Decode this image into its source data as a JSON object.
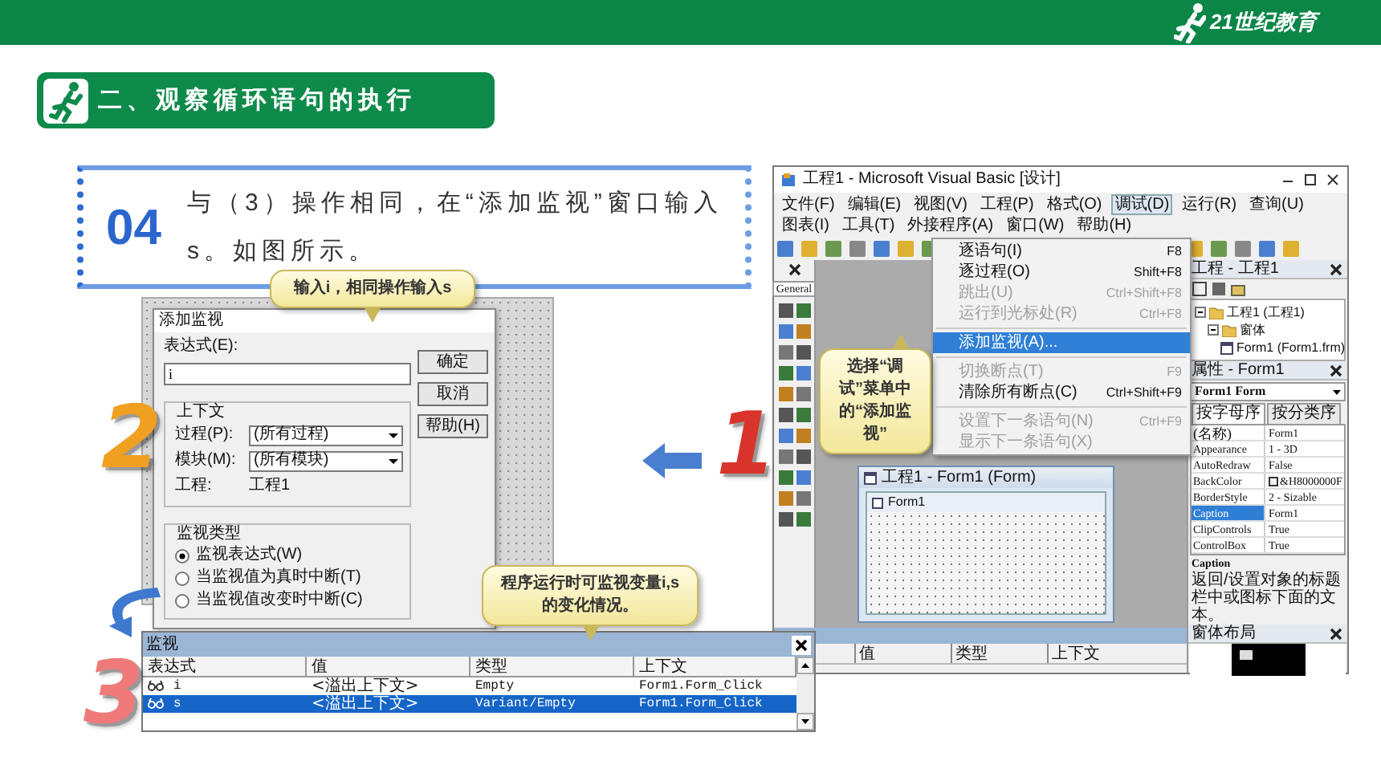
{
  "header": {
    "logo_text": "21世纪教育"
  },
  "section": {
    "title": "二、观察循环语句的执行"
  },
  "step": {
    "number": "04",
    "text": "与（3）操作相同，在“添加监视”窗口输入s。如图所示。"
  },
  "big_numbers": [
    {
      "label": "1",
      "color": "#d9342b"
    },
    {
      "label": "2",
      "color": "#f0a020"
    },
    {
      "label": "3",
      "color": "#f07a7a"
    }
  ],
  "vb": {
    "title": "工程1 - Microsoft Visual Basic [设计]",
    "menu": [
      {
        "label": "文件(F)",
        "selected": false
      },
      {
        "label": "编辑(E)",
        "selected": false
      },
      {
        "label": "视图(V)",
        "selected": false
      },
      {
        "label": "工程(P)",
        "selected": false
      },
      {
        "label": "格式(O)",
        "selected": false
      },
      {
        "label": "调试(D)",
        "selected": true
      },
      {
        "label": "运行(R)",
        "selected": false
      },
      {
        "label": "查询(U)",
        "selected": false
      },
      {
        "label": "图表(I)",
        "selected": false
      },
      {
        "label": "工具(T)",
        "selected": false
      },
      {
        "label": "外接程序(A)",
        "selected": false
      },
      {
        "label": "窗口(W)",
        "selected": false
      },
      {
        "label": "帮助(H)",
        "selected": false
      }
    ],
    "debug_menu": [
      {
        "kind": "item",
        "label": "逐语句(I)",
        "shortcut": "F8",
        "disabled": false,
        "selected": false
      },
      {
        "kind": "item",
        "label": "逐过程(O)",
        "shortcut": "Shift+F8",
        "disabled": false,
        "selected": false
      },
      {
        "kind": "item",
        "label": "跳出(U)",
        "shortcut": "Ctrl+Shift+F8",
        "disabled": true,
        "selected": false
      },
      {
        "kind": "item",
        "label": "运行到光标处(R)",
        "shortcut": "Ctrl+F8",
        "disabled": true,
        "selected": false
      },
      {
        "kind": "separator"
      },
      {
        "kind": "item",
        "label": "添加监视(A)...",
        "disabled": false,
        "selected": true
      },
      {
        "kind": "separator"
      },
      {
        "kind": "item",
        "label": "切换断点(T)",
        "shortcut": "F9",
        "disabled": true,
        "selected": false
      },
      {
        "kind": "item",
        "label": "清除所有断点(C)",
        "shortcut": "Ctrl+Shift+F9",
        "disabled": false,
        "selected": false
      },
      {
        "kind": "separator"
      },
      {
        "kind": "item",
        "label": "设置下一条语句(N)",
        "shortcut": "Ctrl+F9",
        "disabled": true,
        "selected": false
      },
      {
        "kind": "item",
        "label": "显示下一条语句(X)",
        "disabled": true,
        "selected": false
      }
    ],
    "callout": "选择“调试”菜单中的“添加监视”",
    "toolbox_title": "General",
    "form_window_title": "工程1 - Form1 (Form)",
    "form_title": "Form1",
    "project": {
      "title": "工程 - 工程1",
      "tree": [
        {
          "label": "工程1 (工程1)",
          "expanded": true,
          "children": [
            {
              "label": "窗体",
              "expanded": true,
              "children": [
                {
                  "label": "Form1 (Form1.frm)"
                }
              ]
            }
          ]
        }
      ]
    },
    "properties": {
      "title": "属性 - Form1",
      "object": "Form1 Form",
      "tabs": [
        {
          "label": "按字母序",
          "selected": true
        },
        {
          "label": "按分类序",
          "selected": false
        }
      ],
      "rows": [
        {
          "kind": "text",
          "name": "(名称)",
          "value": "Form1",
          "selected": false
        },
        {
          "kind": "text",
          "name": "Appearance",
          "value": "1 - 3D",
          "selected": false
        },
        {
          "kind": "text",
          "name": "AutoRedraw",
          "value": "False",
          "selected": false
        },
        {
          "kind": "color",
          "name": "BackColor",
          "value": "&H8000000F",
          "selected": false
        },
        {
          "kind": "text",
          "name": "BorderStyle",
          "value": "2 - Sizable",
          "selected": false
        },
        {
          "kind": "text",
          "name": "Caption",
          "value": "Form1",
          "selected": true
        },
        {
          "kind": "text",
          "name": "ClipControls",
          "value": "True",
          "selected": false
        },
        {
          "kind": "text",
          "name": "ControlBox",
          "value": "True",
          "selected": false
        }
      ],
      "desc_title": "Caption",
      "desc_text": "返回/设置对象的标题栏中或图标下面的文本。"
    },
    "layout_title": "窗体布局",
    "watch_columns": [
      "值",
      "类型",
      "上下文"
    ]
  },
  "add_watch": {
    "title": "添加监视",
    "expression_label": "表达式(E):",
    "expression": "i",
    "buttons": [
      "确定",
      "取消",
      "帮助(H)"
    ],
    "context_title": "上下文",
    "procedure_label": "过程(P):",
    "procedure": "(所有过程)",
    "module_label": "模块(M):",
    "module": "(所有模块)",
    "project_label": "工程:",
    "project": "工程1",
    "type_title": "监视类型",
    "types": [
      {
        "label": "监视表达式(W)",
        "selected": true
      },
      {
        "label": "当监视值为真时中断(T)",
        "selected": false
      },
      {
        "label": "当监视值改变时中断(C)",
        "selected": false
      }
    ],
    "callout": "输入i，相同操作输入s"
  },
  "watch": {
    "title": "监视",
    "columns": [
      "表达式",
      "值",
      "类型",
      "上下文"
    ],
    "rows": [
      {
        "expression": "i",
        "value": "<溢出上下文>",
        "type": "Empty",
        "context": "Form1.Form_Click",
        "selected": false
      },
      {
        "expression": "s",
        "value": "<溢出上下文>",
        "type": "Variant/Empty",
        "context": "Form1.Form_Click",
        "selected": true
      }
    ],
    "callout": "程序运行时可监视变量i,s的变化情况。"
  }
}
